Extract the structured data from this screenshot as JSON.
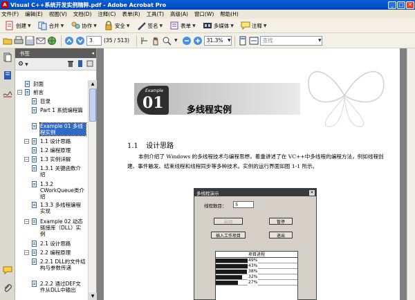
{
  "window": {
    "title": "Visual C++系统开发实例精粹.pdf - Adobe Acrobat Pro",
    "app_icon_letter": "A"
  },
  "menu": [
    "文件(F)",
    "编辑(E)",
    "视图(V)",
    "文档(D)",
    "注释(C)",
    "表单(R)",
    "工具(T)",
    "高级(A)",
    "窗口(W)",
    "帮助(H)"
  ],
  "toolbar1": {
    "create": "创建",
    "combine": "合并",
    "collaborate": "协作",
    "secure": "安全",
    "sign": "签名",
    "forms": "表单",
    "multimedia": "多媒体",
    "comment": "注释"
  },
  "toolbar2": {
    "page_number": "3",
    "page_total": "(35 / 513)",
    "zoom": "31.3%",
    "find_placeholder": "查找"
  },
  "bookmarks": {
    "panel_title": "书签",
    "items": [
      {
        "label": "封面",
        "toggle": ""
      },
      {
        "label": "前言",
        "toggle": "⊟"
      },
      {
        "label": "目录",
        "toggle": ""
      },
      {
        "label": "Part 1  系统编程篇",
        "toggle": ""
      },
      {
        "label": "Example 01  多线程实例",
        "toggle": "",
        "selected": true
      },
      {
        "label": "1.1  设计思路",
        "toggle": "⊟"
      },
      {
        "label": "1.2  编程原理",
        "toggle": ""
      },
      {
        "label": "1.3  实例详解",
        "toggle": "⊟"
      },
      {
        "label": "1.3.1  关键函数介绍",
        "toggle": ""
      },
      {
        "label": "1.3.2  CWorkQueue类介绍",
        "toggle": ""
      },
      {
        "label": "1.3.3  多线程编程实现",
        "toggle": ""
      },
      {
        "label": "Example 02  动态链接库（DLL）实例",
        "toggle": "⊟"
      },
      {
        "label": "2.1  设计思路",
        "toggle": ""
      },
      {
        "label": "2.2  编程原理",
        "toggle": "⊟"
      },
      {
        "label": "2.2.1  DLL的文件结构与参数传递",
        "toggle": ""
      },
      {
        "label": "2.2.2  通过DEF文件从DLL中输出",
        "toggle": ""
      }
    ]
  },
  "page": {
    "badge_small": "Example",
    "badge_number": "01",
    "chapter_title": "多线程实例",
    "section_number": "1.1",
    "section_title": "设计思路",
    "paragraph": "本例介绍了 Windows 的多线程技术与编程思想，着重讲述了在 VC++中多线程的编程方法，例如线程创建、事件触发、结束线程和线程同步等多种技术。实例的运行界面如图 1-1 所示。",
    "dialog": {
      "title": "多线程演示",
      "thread_count_label": "线程数目：",
      "thread_count": "5",
      "start_button": "启动",
      "pause_button": "暂停",
      "insert_button": "插入工作项目",
      "exit_button": "退出",
      "progress_header": "项目进程",
      "progress_values": [
        {
          "label": "49%",
          "fraction": 0.49
        },
        {
          "label": "43%",
          "fraction": 0.43
        },
        {
          "label": "38%",
          "fraction": 0.38
        },
        {
          "label": "32%",
          "fraction": 0.32
        },
        {
          "label": "27%",
          "fraction": 0.27
        }
      ]
    }
  }
}
